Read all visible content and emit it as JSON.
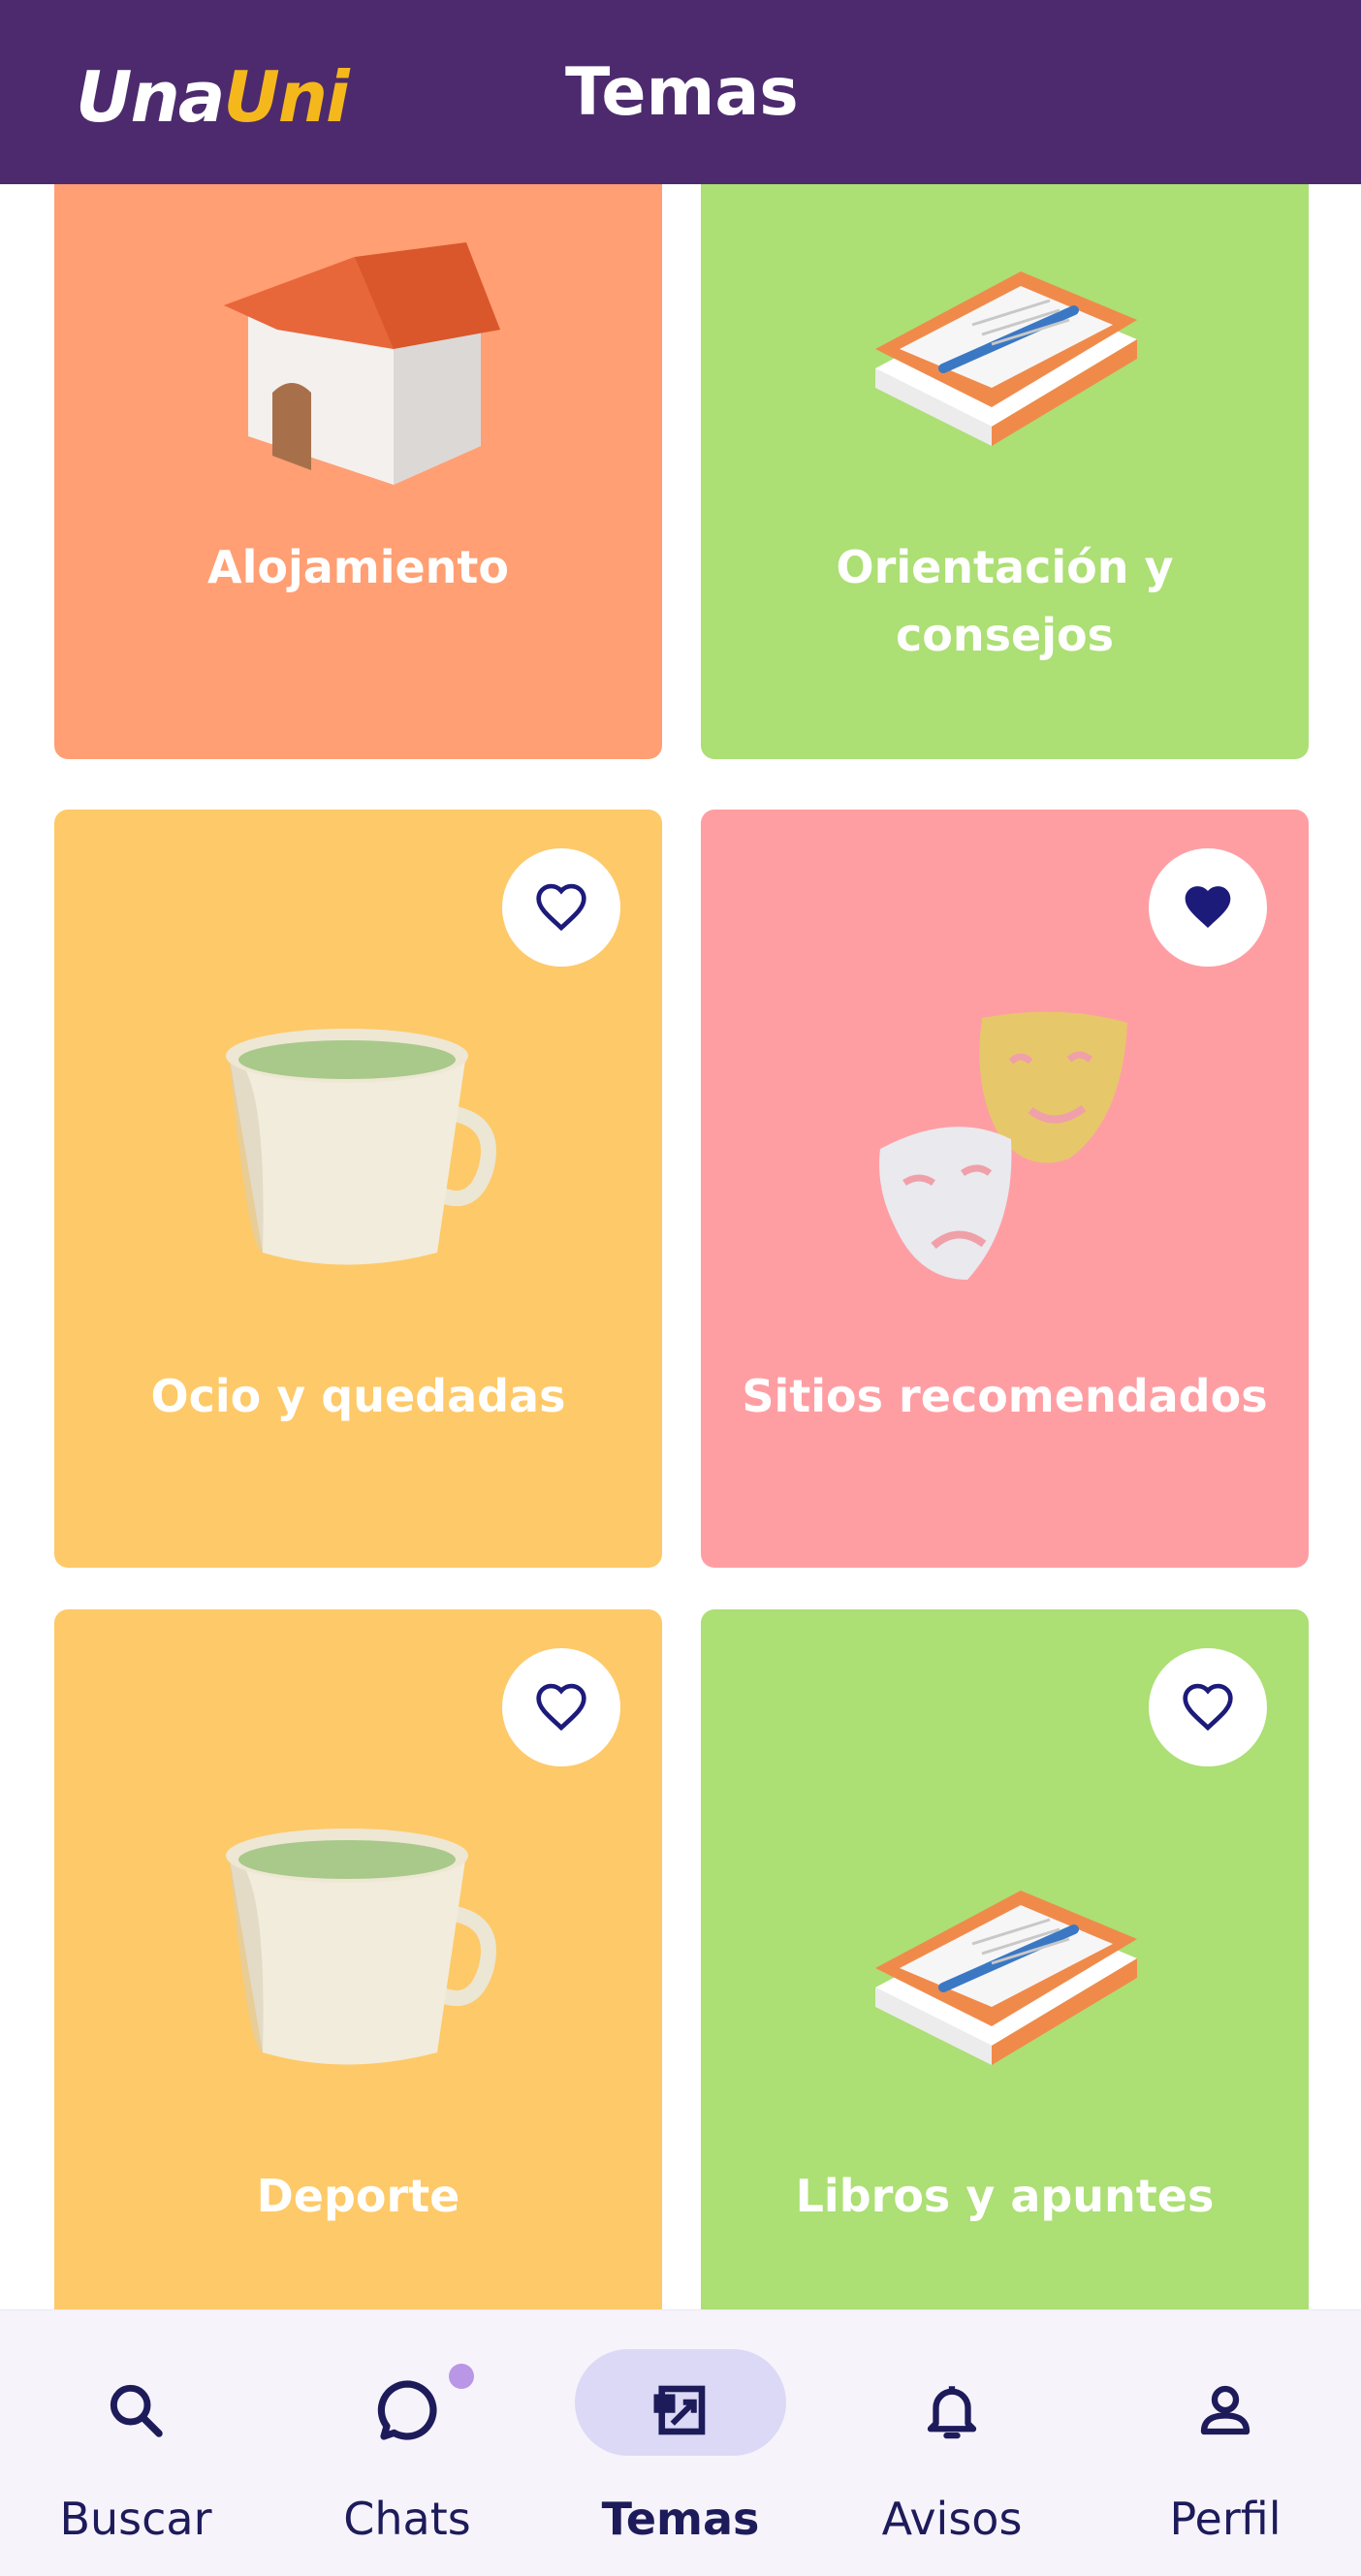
{
  "header": {
    "logo_part1": "Una",
    "logo_part2": "Uni",
    "title": "Temas"
  },
  "colors": {
    "header_bg": "#4d2a6e",
    "logo_accent": "#f5b81c",
    "orange": "#ff9f73",
    "green": "#acdf74",
    "yellow": "#fec968",
    "pink": "#fe9ea3",
    "heart": "#1d1b7a"
  },
  "topics": [
    {
      "label": "Alojamiento",
      "illustration": "house-icon",
      "favorite": null
    },
    {
      "label": "Orientación y consejos",
      "illustration": "book-pen-icon",
      "favorite": null
    },
    {
      "label": "Ocio y quedadas",
      "illustration": "cup-icon",
      "favorite": false
    },
    {
      "label": "Sitios recomendados",
      "illustration": "theater-masks-icon",
      "favorite": true
    },
    {
      "label": "Deporte",
      "illustration": "cup-icon",
      "favorite": false
    },
    {
      "label": "Libros y apuntes",
      "illustration": "book-pen-icon",
      "favorite": false
    }
  ],
  "nav": {
    "items": [
      {
        "label": "Buscar",
        "icon": "search-icon"
      },
      {
        "label": "Chats",
        "icon": "chat-icon",
        "badge": true
      },
      {
        "label": "Temas",
        "icon": "topics-icon",
        "active": true
      },
      {
        "label": "Avisos",
        "icon": "bell-icon"
      },
      {
        "label": "Perfil",
        "icon": "profile-icon"
      }
    ]
  }
}
